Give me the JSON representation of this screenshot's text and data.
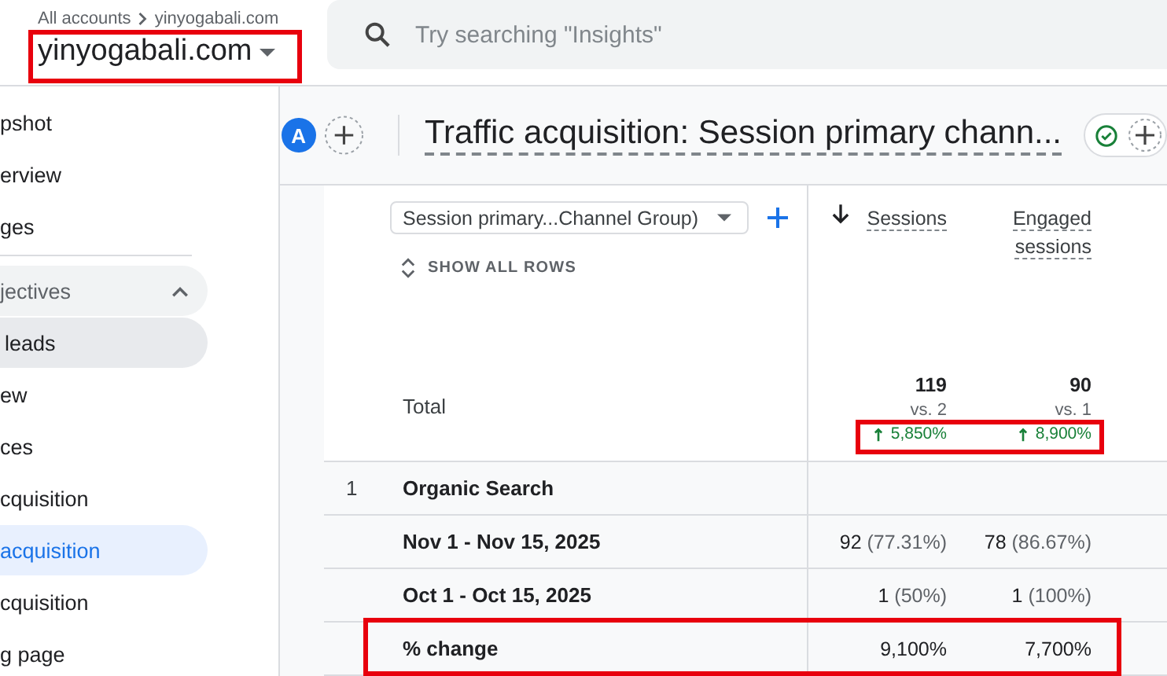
{
  "header": {
    "breadcrumb": [
      "All accounts",
      "yinyogabali.com"
    ],
    "account": {
      "name": "yinyogabali.com",
      "highlighted": true
    },
    "search": {
      "placeholder": "Try searching \"Insights\""
    }
  },
  "sidebar": {
    "items": [
      {
        "label": "pshot",
        "kind": "item",
        "selected": false
      },
      {
        "label": "erview",
        "kind": "item",
        "selected": false
      },
      {
        "label": "ges",
        "kind": "item",
        "selected": false
      },
      {
        "label": "jectives",
        "kind": "group",
        "expanded": true,
        "selected": false
      },
      {
        "label": "leads",
        "kind": "subgroup",
        "selected": false
      },
      {
        "label": "ew",
        "kind": "item",
        "selected": false
      },
      {
        "label": "ces",
        "kind": "item",
        "selected": false
      },
      {
        "label": "cquisition",
        "kind": "item",
        "selected": false
      },
      {
        "label": "acquisition",
        "kind": "item",
        "selected": true
      },
      {
        "label": "cquisition",
        "kind": "item",
        "selected": false
      },
      {
        "label": "g page",
        "kind": "item",
        "selected": false
      }
    ]
  },
  "toolbar": {
    "avatar": "A",
    "title": "Traffic acquisition: Session primary chann..."
  },
  "table": {
    "dimension": "Session primary...Channel Group)",
    "show_all": "SHOW ALL ROWS",
    "columns": [
      {
        "label": "Sessions",
        "sorted": true
      },
      {
        "label": "Engaged sessions",
        "sorted": false
      }
    ],
    "total": {
      "label": "Total",
      "changes_highlighted": true,
      "cells": [
        {
          "value": "119",
          "compare": "vs. 2",
          "change": "5,850%"
        },
        {
          "value": "90",
          "compare": "vs. 1",
          "change": "8,900%"
        }
      ]
    },
    "rows": [
      {
        "index": "1",
        "label": "Organic Search",
        "highlighted": false,
        "cells": []
      },
      {
        "label": "Nov 1 - Nov 15, 2025",
        "highlighted": false,
        "cells": [
          {
            "value": "92",
            "share": "(77.31%)"
          },
          {
            "value": "78",
            "share": "(86.67%)"
          }
        ]
      },
      {
        "label": "Oct 1 - Oct 15, 2025",
        "highlighted": false,
        "cells": [
          {
            "value": "1",
            "share": "(50%)"
          },
          {
            "value": "1",
            "share": "(100%)"
          }
        ]
      },
      {
        "label": "% change",
        "highlighted": true,
        "cells": [
          {
            "value": "9,100%"
          },
          {
            "value": "7,700%"
          }
        ]
      }
    ]
  }
}
